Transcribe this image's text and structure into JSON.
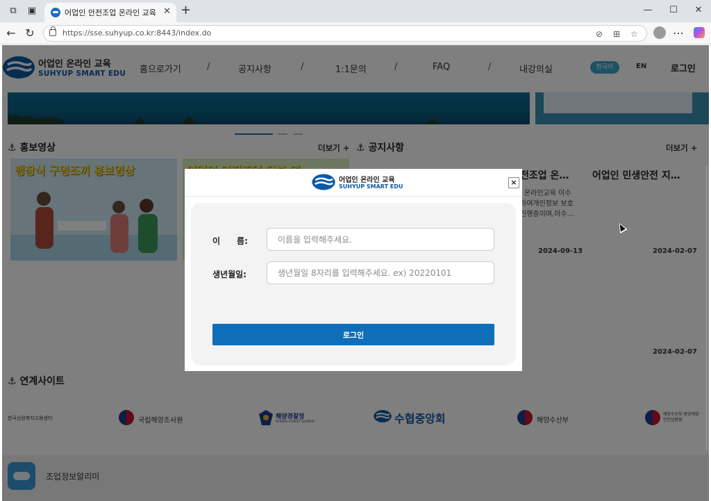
{
  "browser": {
    "tab_title": "어업인 안전조업 온라인 교육",
    "url": "https://sse.suhyup.co.kr:8443/index.do",
    "colors": {
      "tabbar": "#dfe3e8",
      "toolbar": "#f7f7f7"
    }
  },
  "header": {
    "logo_title": "어업인 온라인 교육",
    "logo_subtitle": "SUHYUP SMART EDU",
    "menu": [
      "홈으로가기",
      "1:1문의",
      "FAQ",
      "내강의실"
    ],
    "menu_notice": "공지사항",
    "separator": "/",
    "lang_ko": "한국어",
    "lang_en": "EN",
    "login": "로그인"
  },
  "promo": {
    "title": "홍보영상",
    "more": "더보기 +",
    "video1_title": "팽창식 구명조끼 홍보영상",
    "video2_title": "어업인 안전조업 당부 영"
  },
  "notice": {
    "title": "공지사항",
    "more": "더보기 +",
    "items": [
      {
        "title": "전조업 온…",
        "body": [
          "l 온라인교육 이수",
          "하여개인정보 보호",
          "진행중이며,이수…"
        ],
        "date": "2024-09-13"
      },
      {
        "title": "어업인 민생안전 지…",
        "date": "2024-02-07"
      }
    ],
    "extra_date": "2024-02-07"
  },
  "partners": {
    "title": "연계사이트",
    "items": [
      "한국선원복지고용센터",
      "국립해양조사원",
      "해양경찰청",
      "수협중앙회",
      "해양수산부",
      "해양수산부 중앙해양안전심판원"
    ],
    "coast_guard_en": "KOREA COAST GUARD"
  },
  "footer": {
    "app_label": "조업정보알리미"
  },
  "modal": {
    "logo_title": "어업인 온라인 교육",
    "logo_subtitle": "SUHYUP SMART EDU",
    "close": "×",
    "name_label": "이　　름:",
    "name_placeholder": "이름을 입력해주세요.",
    "birth_label": "생년월일:",
    "birth_placeholder": "생년월일 8자리를 입력해주세요. ex) 20220101",
    "login_button": "로그인",
    "colors": {
      "button": "#0e6fb8",
      "brand_blue": "#0e58a5"
    }
  }
}
